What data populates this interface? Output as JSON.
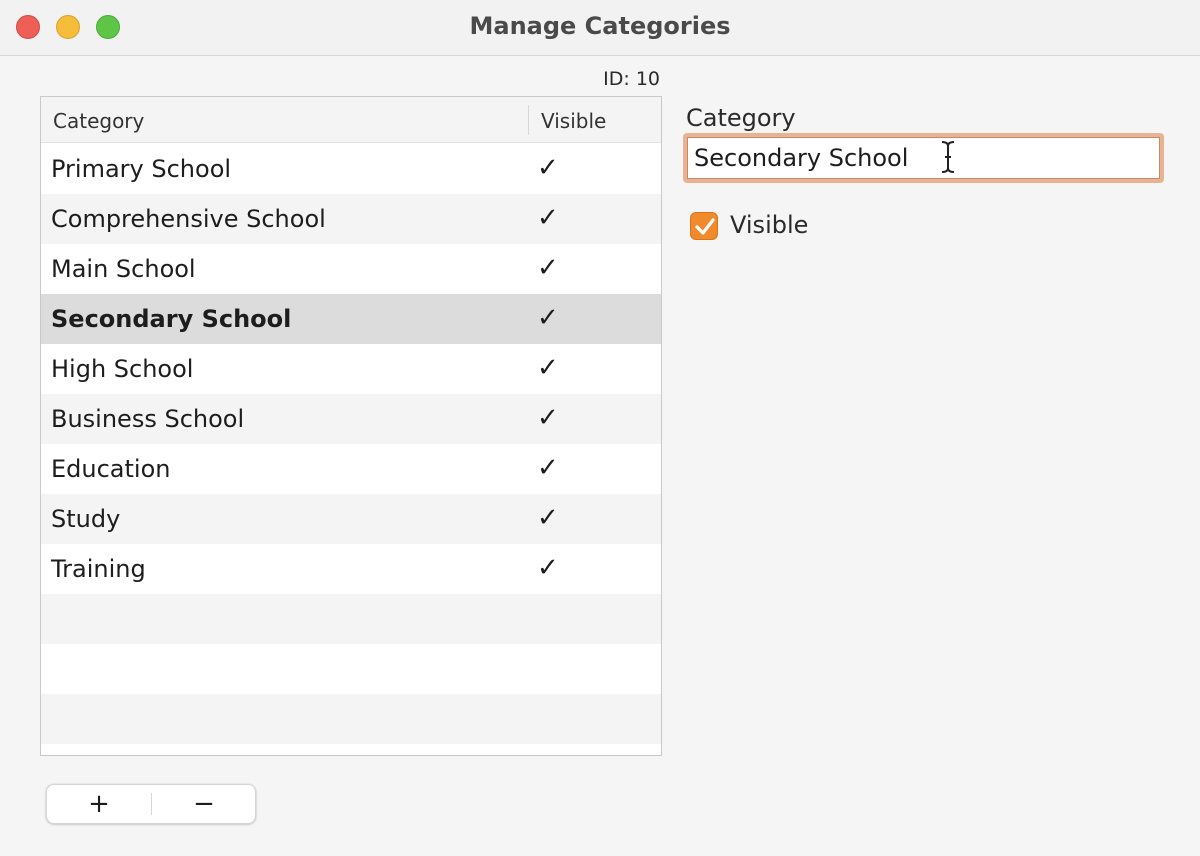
{
  "window": {
    "title": "Manage Categories"
  },
  "record": {
    "id_label": "ID: 10"
  },
  "table": {
    "columns": {
      "category": "Category",
      "visible": "Visible"
    },
    "check_glyph": "✓",
    "rows": [
      {
        "name": "Primary School",
        "visible": true
      },
      {
        "name": "Comprehensive School",
        "visible": true
      },
      {
        "name": "Main School",
        "visible": true
      },
      {
        "name": "Secondary School",
        "visible": true,
        "selected": true
      },
      {
        "name": "High School",
        "visible": true
      },
      {
        "name": "Business School",
        "visible": true
      },
      {
        "name": "Education",
        "visible": true
      },
      {
        "name": "Study",
        "visible": true
      },
      {
        "name": "Training",
        "visible": true
      }
    ]
  },
  "buttons": {
    "add_label": "+",
    "remove_label": "−"
  },
  "detail": {
    "category_label": "Category",
    "category_value": "Secondary School",
    "visible_label": "Visible",
    "visible_checked": true
  },
  "colors": {
    "accent": "#f08a2c",
    "focus_ring": "#e8b392",
    "selected_row": "#dcdcdc",
    "traffic_close": "#ee5f58",
    "traffic_minimize": "#f6bd3b",
    "traffic_zoom": "#5fc547"
  }
}
